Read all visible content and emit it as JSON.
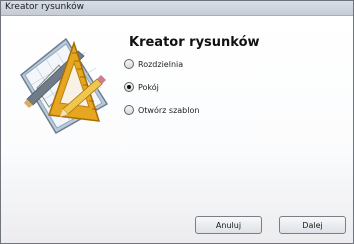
{
  "window": {
    "title": "Kreator rysunków"
  },
  "wizard": {
    "heading": "Kreator rysunków",
    "illustration": "drafting-tools-icon",
    "options": [
      {
        "label": "Rozdzielnia",
        "selected": false
      },
      {
        "label": "Pokój",
        "selected": true
      },
      {
        "label": "Otwórz szablon",
        "selected": false
      }
    ]
  },
  "buttons": {
    "cancel_label": "Anuluj",
    "next_label": "Dalej"
  }
}
